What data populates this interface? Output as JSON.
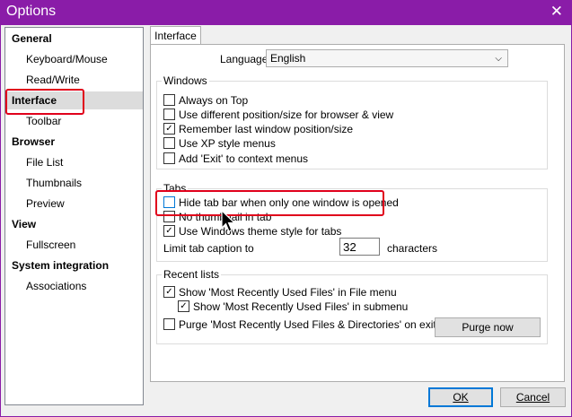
{
  "window": {
    "title": "Options",
    "close_glyph": "✕"
  },
  "tree": [
    {
      "label": "General",
      "kind": "category"
    },
    {
      "label": "Keyboard/Mouse",
      "kind": "item"
    },
    {
      "label": "Read/Write",
      "kind": "item"
    },
    {
      "label": "Interface",
      "kind": "category",
      "selected": true
    },
    {
      "label": "Toolbar",
      "kind": "item"
    },
    {
      "label": "Browser",
      "kind": "category"
    },
    {
      "label": "File List",
      "kind": "item"
    },
    {
      "label": "Thumbnails",
      "kind": "item"
    },
    {
      "label": "Preview",
      "kind": "item"
    },
    {
      "label": "View",
      "kind": "category"
    },
    {
      "label": "Fullscreen",
      "kind": "item"
    },
    {
      "label": "System integration",
      "kind": "category"
    },
    {
      "label": "Associations",
      "kind": "item"
    }
  ],
  "tab": {
    "label": "Interface"
  },
  "language": {
    "label": "Language",
    "value": "English"
  },
  "windows_group": {
    "title": "Windows",
    "options": [
      {
        "label": "Always on Top",
        "checked": false
      },
      {
        "label": "Use different position/size for browser & view",
        "checked": false
      },
      {
        "label": "Remember last window position/size",
        "checked": true
      },
      {
        "label": "Use XP style menus",
        "checked": false
      },
      {
        "label": "Add 'Exit' to context menus",
        "checked": false
      }
    ]
  },
  "tabs_group": {
    "title": "Tabs",
    "options": [
      {
        "label": "Hide tab bar when only one window is opened",
        "checked": false
      },
      {
        "label": "No thumbnail in tab",
        "checked": false
      },
      {
        "label": "Use Windows theme style for tabs",
        "checked": true
      }
    ],
    "limit_label": "Limit tab caption to",
    "limit_value": "32",
    "limit_unit": "characters"
  },
  "recent_group": {
    "title": "Recent lists",
    "options": [
      {
        "label": "Show 'Most Recently Used Files' in File menu",
        "checked": true
      },
      {
        "label": "Show 'Most Recently Used Files' in submenu",
        "checked": true
      },
      {
        "label": "Purge 'Most Recently Used Files & Directories' on exit",
        "checked": false
      }
    ],
    "purge_button": "Purge now"
  },
  "buttons": {
    "ok": "OK",
    "cancel": "Cancel"
  },
  "colors": {
    "titlebar": "#8a1ca8",
    "highlight": "#e0001b",
    "accent": "#0078d7"
  }
}
